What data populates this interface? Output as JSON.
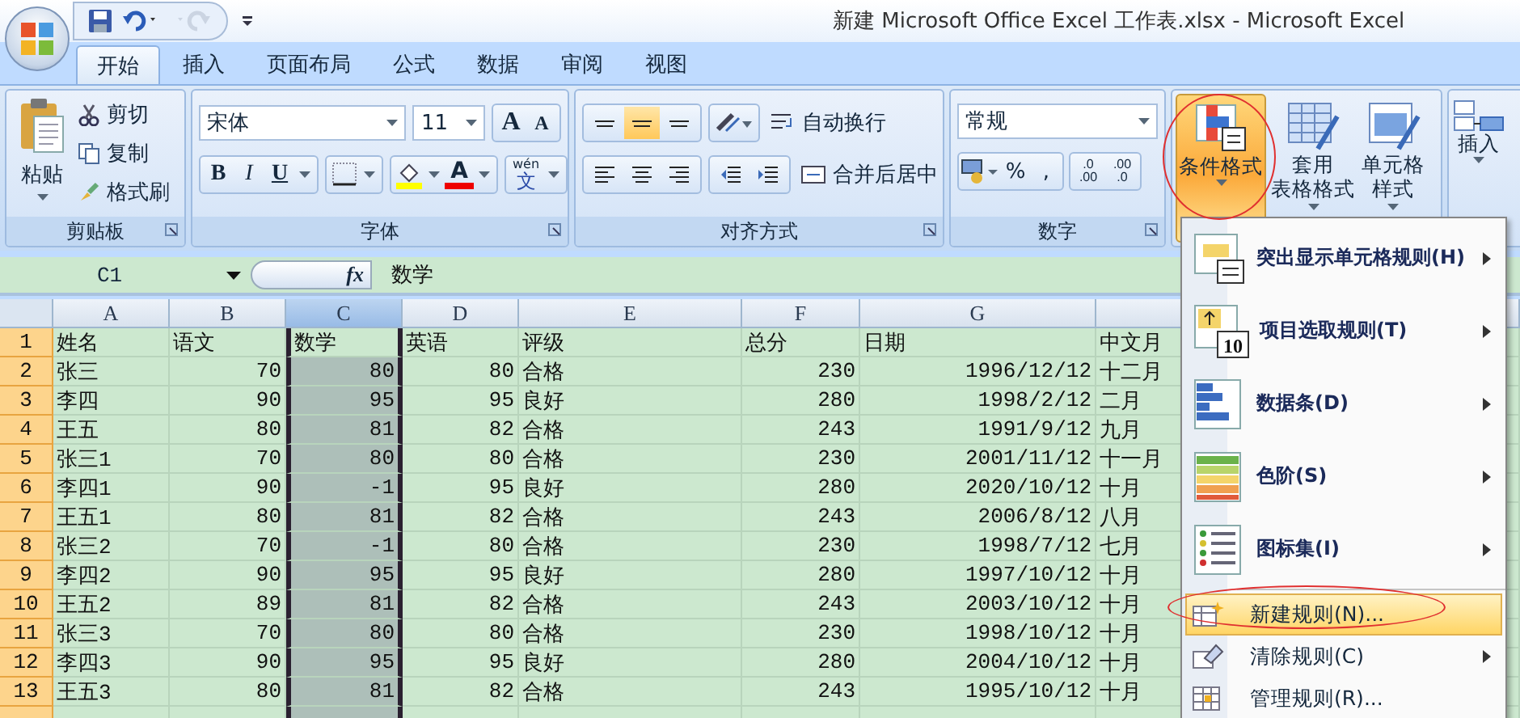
{
  "window": {
    "title": "新建 Microsoft Office Excel 工作表.xlsx - Microsoft Excel"
  },
  "quick_access": [
    {
      "kind": "save",
      "disabled": false
    },
    {
      "kind": "undo",
      "disabled": false
    },
    {
      "kind": "redo",
      "disabled": true
    }
  ],
  "tabs": [
    {
      "label": "开始",
      "selected": true
    },
    {
      "label": "插入",
      "selected": false
    },
    {
      "label": "页面布局",
      "selected": false
    },
    {
      "label": "公式",
      "selected": false
    },
    {
      "label": "数据",
      "selected": false
    },
    {
      "label": "审阅",
      "selected": false
    },
    {
      "label": "视图",
      "selected": false
    }
  ],
  "clipboard": {
    "title": "剪贴板",
    "paste": "粘贴",
    "actions": [
      {
        "kind": "cut",
        "label": "剪切"
      },
      {
        "kind": "copy",
        "label": "复制"
      },
      {
        "kind": "brush",
        "label": "格式刷"
      }
    ]
  },
  "font": {
    "title": "字体",
    "name": "宋体",
    "size": "11",
    "grow": "A",
    "shrink": "A",
    "bold": "B",
    "italic": "I",
    "underline": "U",
    "color_letter": "A",
    "phonetic_top": "wén",
    "phonetic_main": "文"
  },
  "alignment": {
    "title": "对齐方式",
    "vertical": [
      {
        "selected": false
      },
      {
        "selected": true
      },
      {
        "selected": false
      }
    ],
    "wrap": "自动换行",
    "merge": "合并后居中"
  },
  "number": {
    "title": "数字",
    "format": "常规",
    "percent": "%",
    "comma": ",",
    "decimal_buttons": [
      {
        "top": ".0",
        "bottom": ".00"
      },
      {
        "top": ".00",
        "bottom": ".0"
      }
    ]
  },
  "styles": [
    {
      "kind": "conditional",
      "lines": [
        "条件格式"
      ],
      "selected": true
    },
    {
      "kind": "table",
      "lines": [
        "套用",
        "表格格式"
      ],
      "selected": false
    },
    {
      "kind": "cell",
      "lines": [
        "单元格",
        "样式"
      ],
      "selected": false
    }
  ],
  "cells": {
    "insert": "插入"
  },
  "formula_bar": {
    "name_box": "C1",
    "fx": "fx",
    "content": "数学"
  },
  "columns": [
    {
      "letter": "A",
      "kind": "text",
      "selected": false
    },
    {
      "letter": "B",
      "kind": "number",
      "selected": false
    },
    {
      "letter": "C",
      "kind": "number",
      "selected": true
    },
    {
      "letter": "D",
      "kind": "number",
      "selected": false
    },
    {
      "letter": "E",
      "kind": "text",
      "selected": false
    },
    {
      "letter": "F",
      "kind": "number",
      "selected": false
    },
    {
      "letter": "G",
      "kind": "number",
      "selected": false
    },
    {
      "kind": "text",
      "selected": false
    }
  ],
  "rows": [
    {
      "number": "1",
      "cells": [
        "姓名",
        "语文",
        "数学",
        "英语",
        "评级",
        "总分",
        "日期",
        "中文月"
      ]
    },
    {
      "number": "2",
      "cells": [
        "张三",
        "70",
        "80",
        "80",
        "合格",
        "230",
        "1996/12/12",
        "十二月"
      ]
    },
    {
      "number": "3",
      "cells": [
        "李四",
        "90",
        "95",
        "95",
        "良好",
        "280",
        "1998/2/12",
        "二月"
      ]
    },
    {
      "number": "4",
      "cells": [
        "王五",
        "80",
        "81",
        "82",
        "合格",
        "243",
        "1991/9/12",
        "九月"
      ]
    },
    {
      "number": "5",
      "cells": [
        "张三1",
        "70",
        "80",
        "80",
        "合格",
        "230",
        "2001/11/12",
        "十一月"
      ]
    },
    {
      "number": "6",
      "cells": [
        "李四1",
        "90",
        "-1",
        "95",
        "良好",
        "280",
        "2020/10/12",
        "十月"
      ]
    },
    {
      "number": "7",
      "cells": [
        "王五1",
        "80",
        "81",
        "82",
        "合格",
        "243",
        "2006/8/12",
        "八月"
      ]
    },
    {
      "number": "8",
      "cells": [
        "张三2",
        "70",
        "-1",
        "80",
        "合格",
        "230",
        "1998/7/12",
        "七月"
      ]
    },
    {
      "number": "9",
      "cells": [
        "李四2",
        "90",
        "95",
        "95",
        "良好",
        "280",
        "1997/10/12",
        "十月"
      ]
    },
    {
      "number": "10",
      "cells": [
        "王五2",
        "89",
        "81",
        "82",
        "合格",
        "243",
        "2003/10/12",
        "十月"
      ]
    },
    {
      "number": "11",
      "cells": [
        "张三3",
        "70",
        "80",
        "80",
        "合格",
        "230",
        "1998/10/12",
        "十月"
      ]
    },
    {
      "number": "12",
      "cells": [
        "李四3",
        "90",
        "95",
        "95",
        "良好",
        "280",
        "2004/10/12",
        "十月"
      ]
    },
    {
      "number": "13",
      "cells": [
        "王五3",
        "80",
        "81",
        "82",
        "合格",
        "243",
        "1995/10/12",
        "十月"
      ]
    }
  ],
  "menu": {
    "items": [
      {
        "kind": "highlight",
        "label": "突出显示单元格规则(H)",
        "submenu": true,
        "selected": false
      },
      {
        "kind": "top10",
        "label": "项目选取规则(T)",
        "icon_text": "10",
        "submenu": true,
        "selected": false
      },
      {
        "kind": "databar",
        "label": "数据条(D)",
        "submenu": true,
        "selected": false
      },
      {
        "kind": "colorscale",
        "label": "色阶(S)",
        "submenu": true,
        "selected": false
      },
      {
        "kind": "iconset",
        "label": "图标集(I)",
        "submenu": true,
        "selected": false
      },
      {
        "kind": "new",
        "label": "新建规则(N)...",
        "submenu": false,
        "selected": true
      },
      {
        "kind": "clear",
        "label": "清除规则(C)",
        "submenu": true,
        "selected": false
      },
      {
        "kind": "manage",
        "label": "管理规则(R)...",
        "submenu": false,
        "selected": false
      }
    ]
  }
}
